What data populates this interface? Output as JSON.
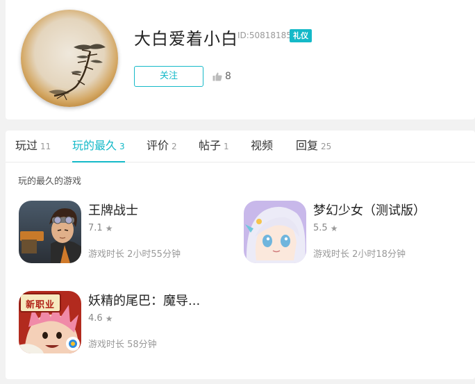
{
  "profile": {
    "username": "大白爱着小白",
    "user_id": "ID:50818185",
    "badge": "礼仪",
    "follow_label": "关注",
    "likes": "8"
  },
  "tabs": [
    {
      "label": "玩过",
      "count": "11",
      "active": false
    },
    {
      "label": "玩的最久",
      "count": "3",
      "active": true
    },
    {
      "label": "评价",
      "count": "2",
      "active": false
    },
    {
      "label": "帖子",
      "count": "1",
      "active": false
    },
    {
      "label": "视频",
      "count": "",
      "active": false
    },
    {
      "label": "回复",
      "count": "25",
      "active": false
    }
  ],
  "section": {
    "title": "玩的最久的游戏"
  },
  "games": [
    {
      "name": "王牌战士",
      "rating": "7.1",
      "duration": "游戏时长 2小时55分钟"
    },
    {
      "name": "梦幻少女（测试版）",
      "rating": "5.5",
      "duration": "游戏时长 2小时18分钟"
    },
    {
      "name": "妖精的尾巴：魔导...",
      "rating": "4.6",
      "duration": "游戏时长 58分钟",
      "icon_text": "新职业"
    }
  ],
  "colors": {
    "accent": "#14b9c8",
    "page_bg": "#f2f2f2"
  }
}
